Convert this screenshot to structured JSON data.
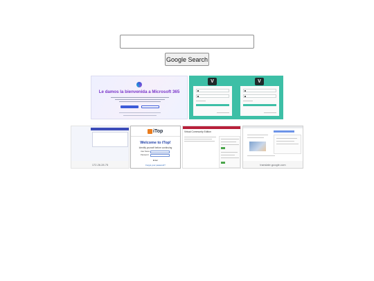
{
  "search": {
    "value": "",
    "placeholder": "",
    "button_label": "Google Search"
  },
  "tiles": {
    "ms365": {
      "title": "Le damos la bienvenida a Microsoft 365"
    },
    "itop": {
      "brand": "iTop",
      "welcome": "Welcome to iTop!",
      "subtitle": "Identify yourself before continuing",
      "enter": "Enter",
      "forgot": "Forgot your password?"
    },
    "ip_tile": {
      "caption": "172.26.28.75"
    },
    "translate": {
      "caption": "translate.google.com"
    },
    "vcenter": {
      "title": "Virtual Community Edition"
    }
  }
}
